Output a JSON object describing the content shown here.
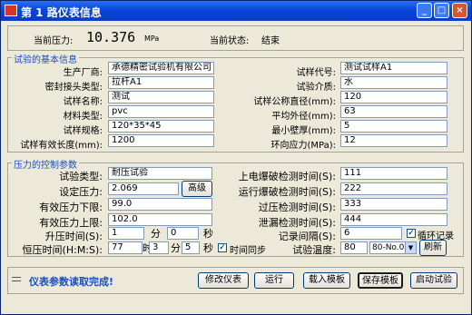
{
  "window": {
    "title": "第 1 路仪表信息",
    "controls": [
      "_",
      "□",
      "×"
    ]
  },
  "header": {
    "pressure_label": "当前压力:",
    "pressure_value": "10.376",
    "pressure_unit": "MPa",
    "state_label": "当前状态:",
    "state_value": "结束"
  },
  "basic_info": {
    "legend": "试验的基本信息",
    "left": [
      {
        "label": "生产厂商:",
        "value": "承德精密试验机有限公司"
      },
      {
        "label": "密封接头类型:",
        "value": "拉杆A1"
      },
      {
        "label": "试样名称:",
        "value": "测试"
      },
      {
        "label": "材料类型:",
        "value": "pvc"
      },
      {
        "label": "试样规格:",
        "value": "120*35*45"
      },
      {
        "label": "试样有效长度(mm):",
        "value": "1200"
      }
    ],
    "right": [
      {
        "label": "试样代号:",
        "value": "测试试样A1"
      },
      {
        "label": "试验介质:",
        "value": "水"
      },
      {
        "label": "试样公称直径(mm):",
        "value": "120"
      },
      {
        "label": "平均外径(mm):",
        "value": "63"
      },
      {
        "label": "最小壁厚(mm):",
        "value": "5"
      },
      {
        "label": "环向应力(MPa):",
        "value": "12"
      }
    ]
  },
  "pressure_control": {
    "legend": "压力的控制参数",
    "test_type_label": "试验类型:",
    "test_type_value": "耐压试验",
    "set_pressure_label": "设定压力:",
    "set_pressure_value": "2.069",
    "high_button": "高级",
    "lower_limit_label": "有效压力下限:",
    "lower_limit_value": "99.0",
    "upper_limit_label": "有效压力上限:",
    "upper_limit_value": "102.0",
    "rise_time_label": "升压时间(S):",
    "rise_time_min": "1",
    "rise_min_unit": "分",
    "rise_time_sec": "0",
    "rise_sec_unit": "秒",
    "hold_time_label": "恒压时间(H:M:S):",
    "hold_h": "77",
    "hold_h_unit": "时",
    "hold_m": "3",
    "hold_m_unit": "分",
    "hold_s": "5",
    "hold_s_unit": "秒",
    "time_sync_label": "时间同步",
    "time_sync_checked": true,
    "right": [
      {
        "label": "上电爆破检测时间(S):",
        "value": "111"
      },
      {
        "label": "运行爆破检测时间(S):",
        "value": "222"
      },
      {
        "label": "过压检测时间(S):",
        "value": "333"
      },
      {
        "label": "泄漏检测时间(S):",
        "value": "444"
      }
    ],
    "record_interval_label": "记录间隔(S):",
    "record_interval_value": "6",
    "loop_record_label": "循环记录",
    "loop_record_checked": true,
    "temp_label": "试验温度:",
    "temp_value": "80",
    "temp_select": "80-No.01",
    "refresh_button": "刷新"
  },
  "footer": {
    "status_message": "仪表参数读取完成!",
    "buttons": [
      "修改仪表",
      "运行",
      "载入模板",
      "保存模板",
      "启动试验"
    ]
  },
  "colors": {
    "title_bar": "#0846d8",
    "status_text": "#1a4ec4",
    "window_bg": "#ece9d8"
  }
}
